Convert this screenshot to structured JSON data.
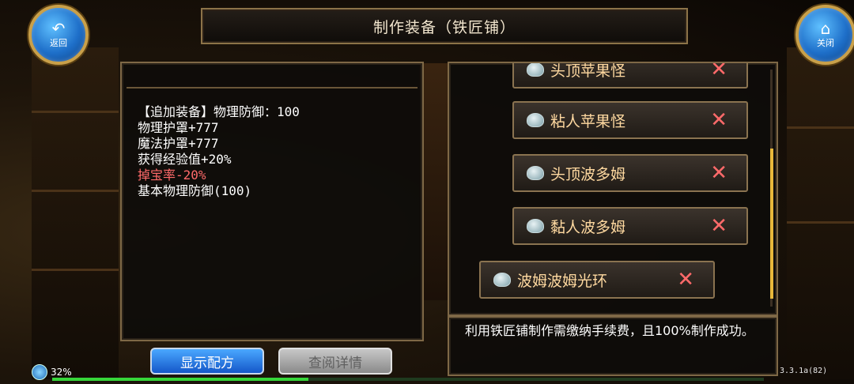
{
  "header": {
    "title": "制作装备（铁匠铺）",
    "back_label": "返回",
    "close_label": "关闭"
  },
  "equipment_stats": [
    {
      "text": "【追加装备】物理防御：100",
      "color": "#ffffff"
    },
    {
      "text": "物理护罩+777",
      "color": "#ffffff"
    },
    {
      "text": "魔法护罩+777",
      "color": "#ffffff"
    },
    {
      "text": "获得经验值+20%",
      "color": "#ffffff"
    },
    {
      "text": "掉宝率-20%",
      "color": "#ff6a6a"
    },
    {
      "text": "基本物理防御(100)",
      "color": "#ffffff"
    }
  ],
  "material_list": {
    "items": [
      {
        "label": "头顶苹果怪",
        "icon": "slime-icon"
      },
      {
        "label": "粘人苹果怪",
        "icon": "slime-icon"
      },
      {
        "label": "头顶波多姆",
        "icon": "slime-icon"
      },
      {
        "label": "黏人波多姆",
        "icon": "slime-icon"
      },
      {
        "label": "波姆波姆光环",
        "icon": "slime-icon"
      }
    ],
    "remove_symbol": "✕"
  },
  "description": "利用铁匠铺制作需缴纳手续费，且100%制作成功。",
  "buttons": {
    "show_recipe": "显示配方",
    "view_detail": "查阅详情"
  },
  "status": {
    "percent": "32%",
    "progress": 0.36,
    "version": "3.3.1a(82)"
  },
  "colors": {
    "accent_gold": "#c9a04a",
    "stat_red": "#ff6a6a",
    "item_text": "#ffd9a0"
  }
}
